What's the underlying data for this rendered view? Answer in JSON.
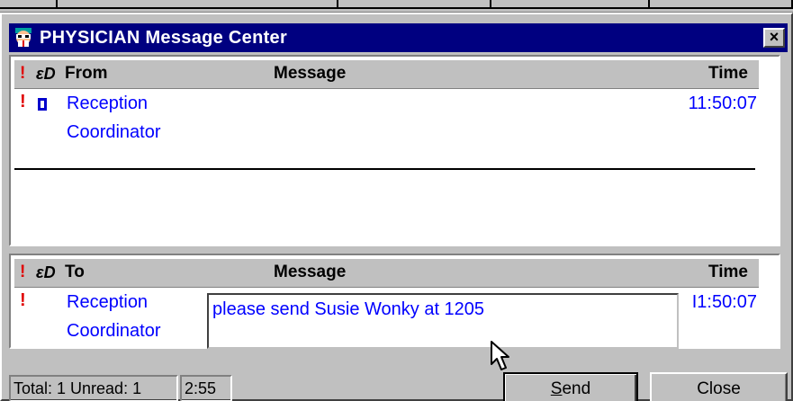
{
  "window": {
    "title": "PHYSICIAN Message Center",
    "close_glyph": "×"
  },
  "inbox": {
    "header": {
      "urgent": "!",
      "read": "ɛD",
      "from": "From",
      "message": "Message",
      "time": "Time"
    },
    "rows": [
      {
        "urgent": "!",
        "from_line1": "Reception",
        "from_line2": "Coordinator",
        "time": "11:50:07",
        "unread": true
      }
    ]
  },
  "outbox": {
    "header": {
      "urgent": "!",
      "read": "ɛD",
      "to": "To",
      "message": "Message",
      "time": "Time"
    },
    "rows": [
      {
        "urgent": "!",
        "to_line1": "Reception",
        "to_line2": "Coordinator",
        "message": "please send Susie Wonky at 1205",
        "time": "I1:50:07"
      }
    ]
  },
  "status": {
    "total": "Total: 1 Unread: 1",
    "clock": "2:55"
  },
  "buttons": {
    "send_first": "S",
    "send_rest": "end",
    "close": "Close"
  },
  "colors": {
    "titlebar": "#000080",
    "link_text": "#0000ff",
    "urgent": "#e00000",
    "face": "#c0c0c0"
  }
}
